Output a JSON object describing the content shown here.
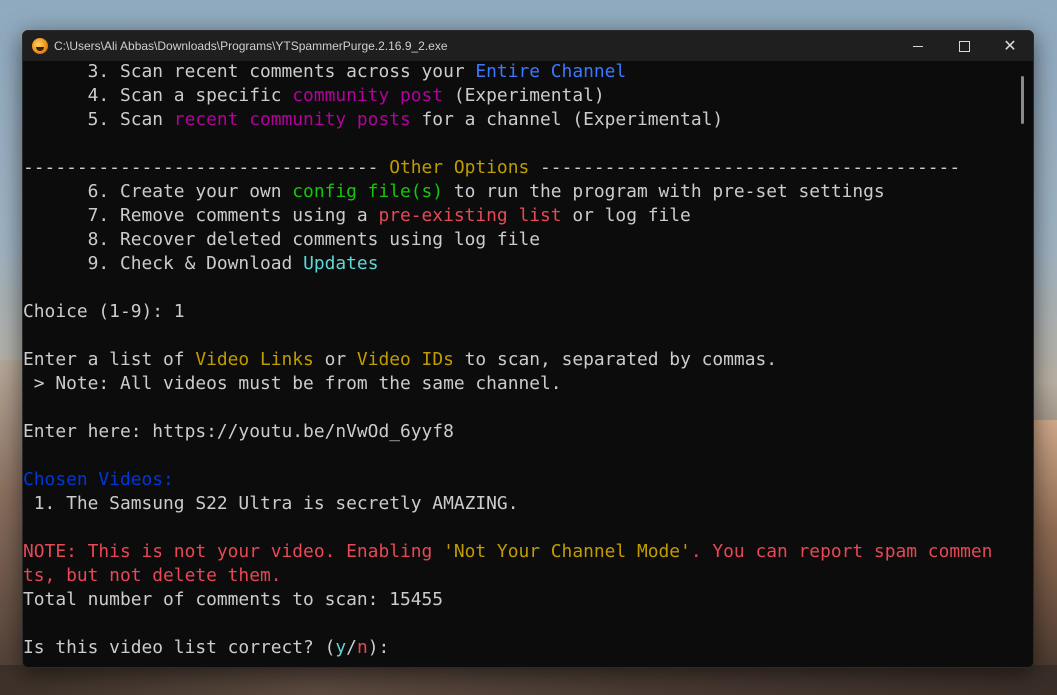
{
  "window": {
    "title": "C:\\Users\\Ali Abbas\\Downloads\\Programs\\YTSpammerPurge.2.16.9_2.exe",
    "controls": {
      "minimize_icon": "minimize-icon",
      "maximize_icon": "maximize-icon",
      "close_icon": "close-icon",
      "close_glyph": "✕"
    }
  },
  "console": {
    "menu_lines": [
      {
        "prefix": "      3. Scan recent comments across your ",
        "highlight": "Entire Channel",
        "suffix": ""
      },
      {
        "prefix": "      4. Scan a specific ",
        "highlight": "community post",
        "suffix": " (Experimental)"
      },
      {
        "prefix": "      5. Scan ",
        "highlight": "recent community posts",
        "suffix": " for a channel (Experimental)"
      }
    ],
    "separator": {
      "left": "--------------------------------- ",
      "title": "Other Options",
      "right": " ---------------------------------------"
    },
    "other_lines": [
      {
        "prefix": "      6. Create your own ",
        "highlight": "config file(s)",
        "suffix": " to run the program with pre-set settings"
      },
      {
        "prefix": "      7. Remove comments using a ",
        "highlight": "pre-existing list",
        "suffix": " or log file"
      },
      {
        "prefix": "      8. Recover deleted comments using log file",
        "highlight": "",
        "suffix": ""
      },
      {
        "prefix": "      9. Check & Download ",
        "highlight": "Updates",
        "suffix": ""
      }
    ],
    "choice_prompt": "Choice (1-9): 1",
    "enter_list": {
      "prefix": "Enter a list of ",
      "hl1": "Video Links",
      "mid": " or ",
      "hl2": "Video IDs",
      "suffix": " to scan, separated by commas."
    },
    "note_same_channel": " > Note: All videos must be from the same channel.",
    "enter_here": "Enter here: https://youtu.be/nVwOd_6yyf8",
    "chosen_videos_label": "Chosen Videos:",
    "chosen_video_1": " 1. The Samsung S22 Ultra is secretly AMAZING.",
    "note_line1": {
      "prefix": "NOTE: This is not your video. Enabling ",
      "highlight": "'Not Your Channel Mode'",
      "suffix": ". You can report spam commen"
    },
    "note_line2": "ts, but not delete them.",
    "total_comments": "Total number of comments to scan: 15455",
    "confirm": {
      "prefix": "Is this video list correct? (",
      "yes": "y",
      "slash": "/",
      "no": "n",
      "suffix": "):"
    }
  }
}
